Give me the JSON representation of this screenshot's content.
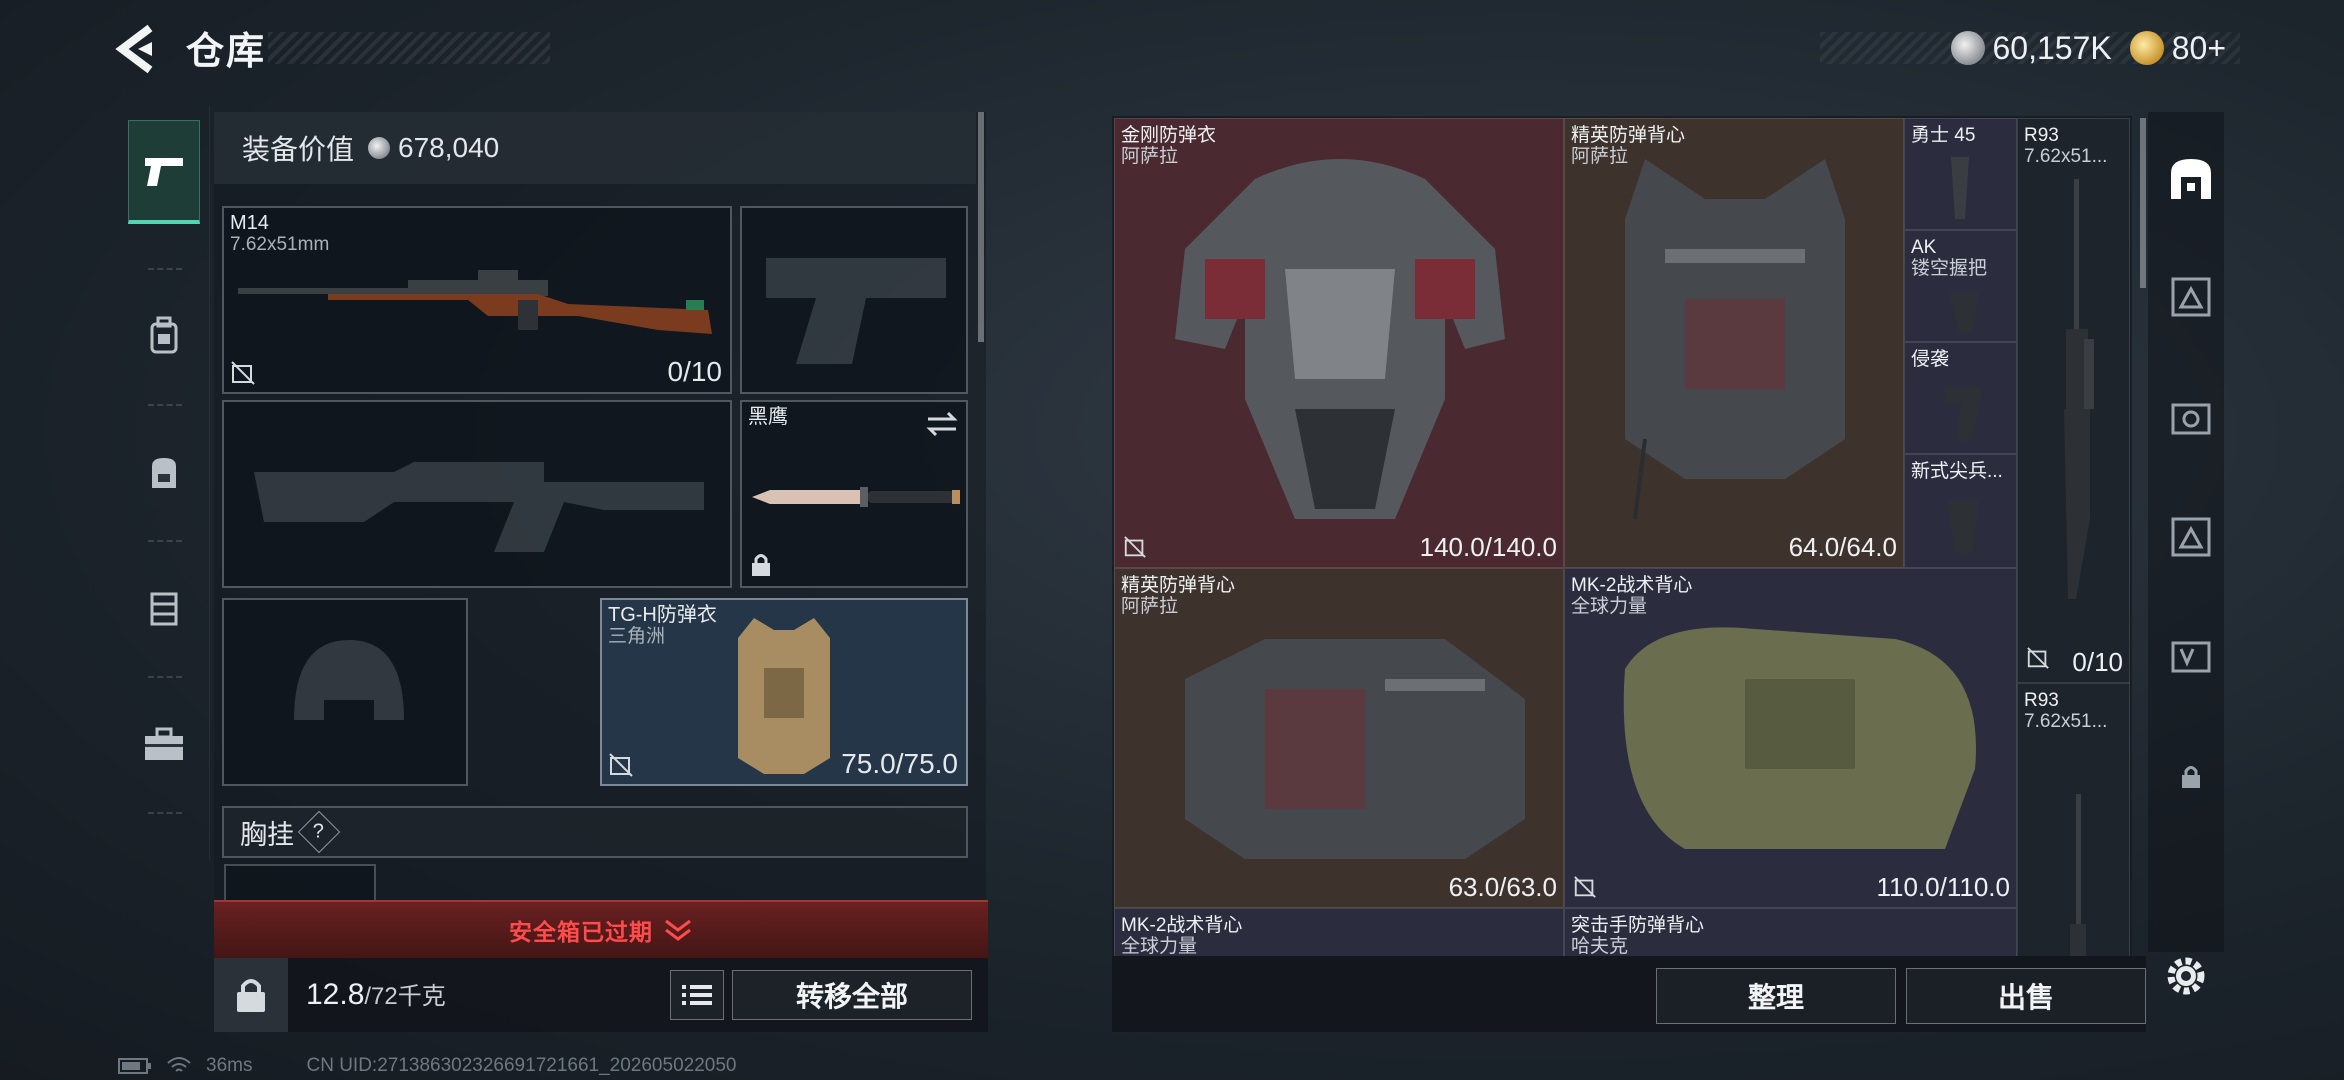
{
  "header": {
    "title": "仓库",
    "currency_1": "60,157K",
    "currency_2": "80+"
  },
  "loadout": {
    "value_label": "装备价值",
    "value": "678,040",
    "slots": {
      "primary": {
        "name": "M14",
        "sub": "7.62x51mm",
        "durability": "0/10"
      },
      "melee": {
        "name": "黑鹰"
      },
      "armor": {
        "name": "TG-H防弹衣",
        "sub": "三角洲",
        "durability": "75.0/75.0"
      }
    },
    "chest_rig_label": "胸挂",
    "chest_rig_help": "?",
    "safe_box_status": "安全箱已过期",
    "weight": "12.8",
    "weight_max": "/72千克",
    "transfer_all": "转移全部"
  },
  "storage": {
    "cells": [
      {
        "name": "金刚防弹衣",
        "sub": "阿萨拉",
        "durability": "140.0/140.0"
      },
      {
        "name": "精英防弹背心",
        "sub": "阿萨拉",
        "durability": "64.0/64.0"
      },
      {
        "name": "勇士 45",
        "sub": ""
      },
      {
        "name": "AK",
        "sub": "镂空握把"
      },
      {
        "name": "侵袭",
        "sub": ""
      },
      {
        "name": "新式尖兵...",
        "sub": ""
      },
      {
        "name": "R93",
        "sub": "7.62x51...",
        "durability": "0/10"
      },
      {
        "name": "精英防弹背心",
        "sub": "阿萨拉",
        "durability": "63.0/63.0"
      },
      {
        "name": "MK-2战术背心",
        "sub": "全球力量",
        "durability": "110.0/110.0"
      },
      {
        "name": "R93",
        "sub": "7.62x51..."
      },
      {
        "name": "MK-2战术背心",
        "sub": "全球力量"
      },
      {
        "name": "突击手防弹背心",
        "sub": "哈夫克"
      }
    ],
    "sort_label": "整理",
    "sell_label": "出售"
  },
  "status_bar": {
    "ping": "36ms",
    "uid": "CN UID:271386302326691721661_202605022050"
  },
  "colors": {
    "accent": "#4fd6b3",
    "expired": "#ff4b4b",
    "red_rarity": "#4a2a30",
    "brown_rarity": "#3e322d",
    "purple_rarity": "#2c2c3f"
  },
  "icons": [
    "back-arrow-icon",
    "silver-coin-icon",
    "gold-coin-icon",
    "pistol-icon",
    "backpack-armor-icon",
    "backpack-icon",
    "chest-rig-icon",
    "toolbox-icon",
    "lock-icon",
    "no-trade-icon",
    "swap-icon",
    "list-icon",
    "chevron-down-icon",
    "gear-icon"
  ]
}
